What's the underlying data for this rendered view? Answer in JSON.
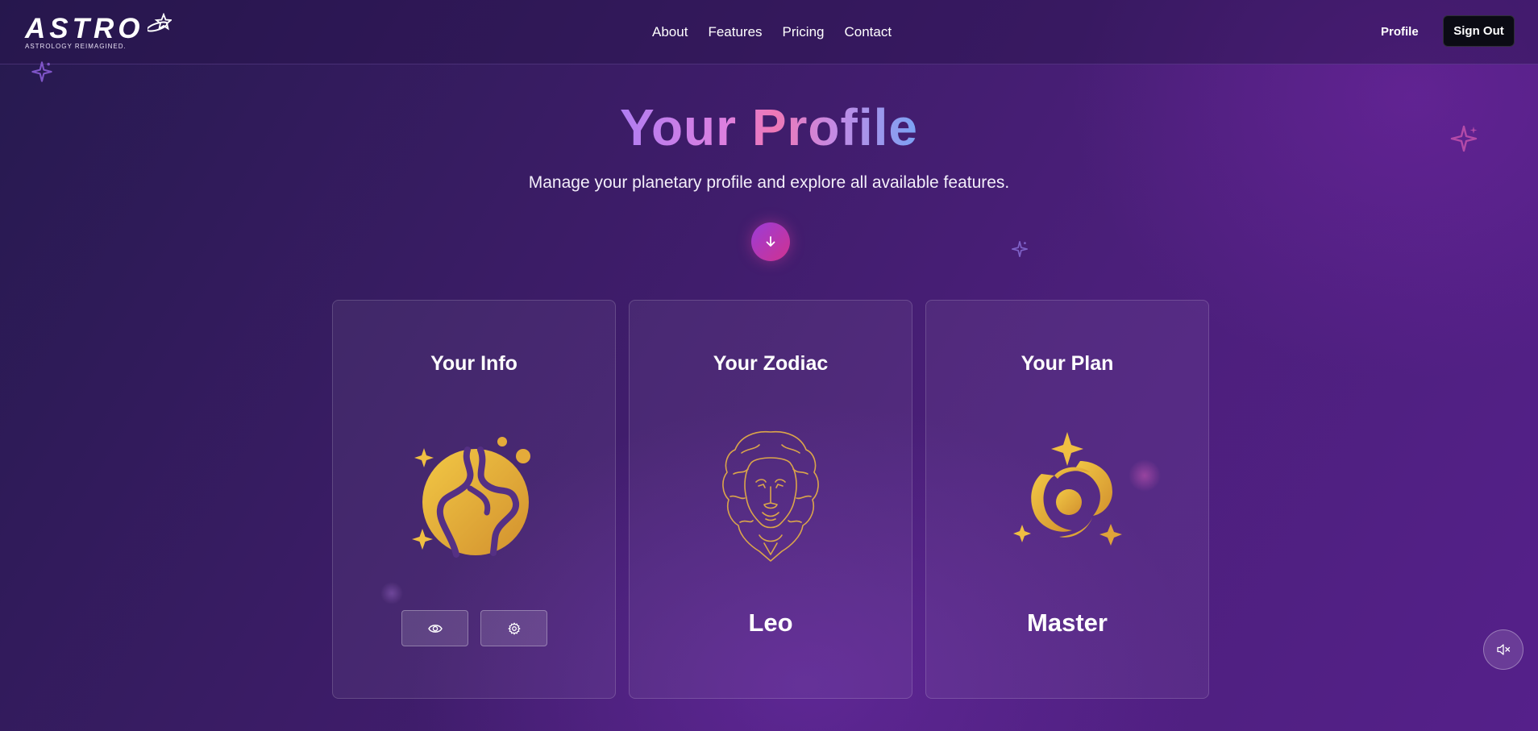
{
  "header": {
    "logo_word": "ASTRO",
    "logo_tagline": "ASTROLOGY REIMAGINED.",
    "nav": [
      "About",
      "Features",
      "Pricing",
      "Contact"
    ],
    "profile_label": "Profile",
    "signout_label": "Sign Out"
  },
  "hero": {
    "title": "Your Profile",
    "subtitle": "Manage your planetary profile and explore all available features."
  },
  "cards": [
    {
      "title": "Your Info",
      "icon": "planet-icon",
      "actions": [
        "eye-icon",
        "gear-icon"
      ]
    },
    {
      "title": "Your Zodiac",
      "icon": "lion-icon",
      "value": "Leo"
    },
    {
      "title": "Your Plan",
      "icon": "galaxy-icon",
      "value": "Master"
    }
  ],
  "colors": {
    "accent_gold": "#e2a93a",
    "title_gradient": [
      "#b07ef2",
      "#ee78b6",
      "#7aa3f4"
    ],
    "button_gradient": [
      "#9b3cd8",
      "#d0328f"
    ]
  }
}
